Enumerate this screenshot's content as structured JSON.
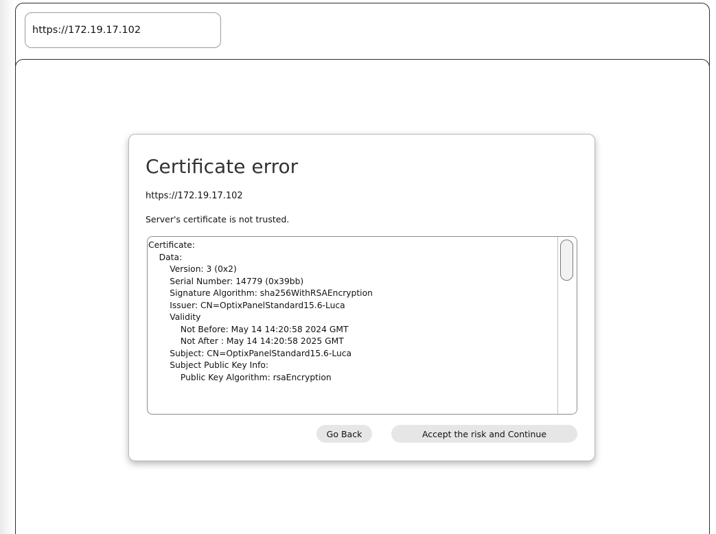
{
  "browser": {
    "url": "https://172.19.17.102"
  },
  "dialog": {
    "title": "Certificate error",
    "url": "https://172.19.17.102",
    "message": "Server's certificate is not trusted.",
    "certificate_lines": [
      "Certificate:",
      "    Data:",
      "        Version: 3 (0x2)",
      "        Serial Number: 14779 (0x39bb)",
      "        Signature Algorithm: sha256WithRSAEncryption",
      "        Issuer: CN=OptixPanelStandard15.6-Luca",
      "        Validity",
      "            Not Before: May 14 14:20:58 2024 GMT",
      "            Not After : May 14 14:20:58 2025 GMT",
      "        Subject: CN=OptixPanelStandard15.6-Luca",
      "        Subject Public Key Info:",
      "            Public Key Algorithm: rsaEncryption"
    ],
    "buttons": {
      "go_back": "Go Back",
      "accept": "Accept the risk and Continue"
    }
  }
}
